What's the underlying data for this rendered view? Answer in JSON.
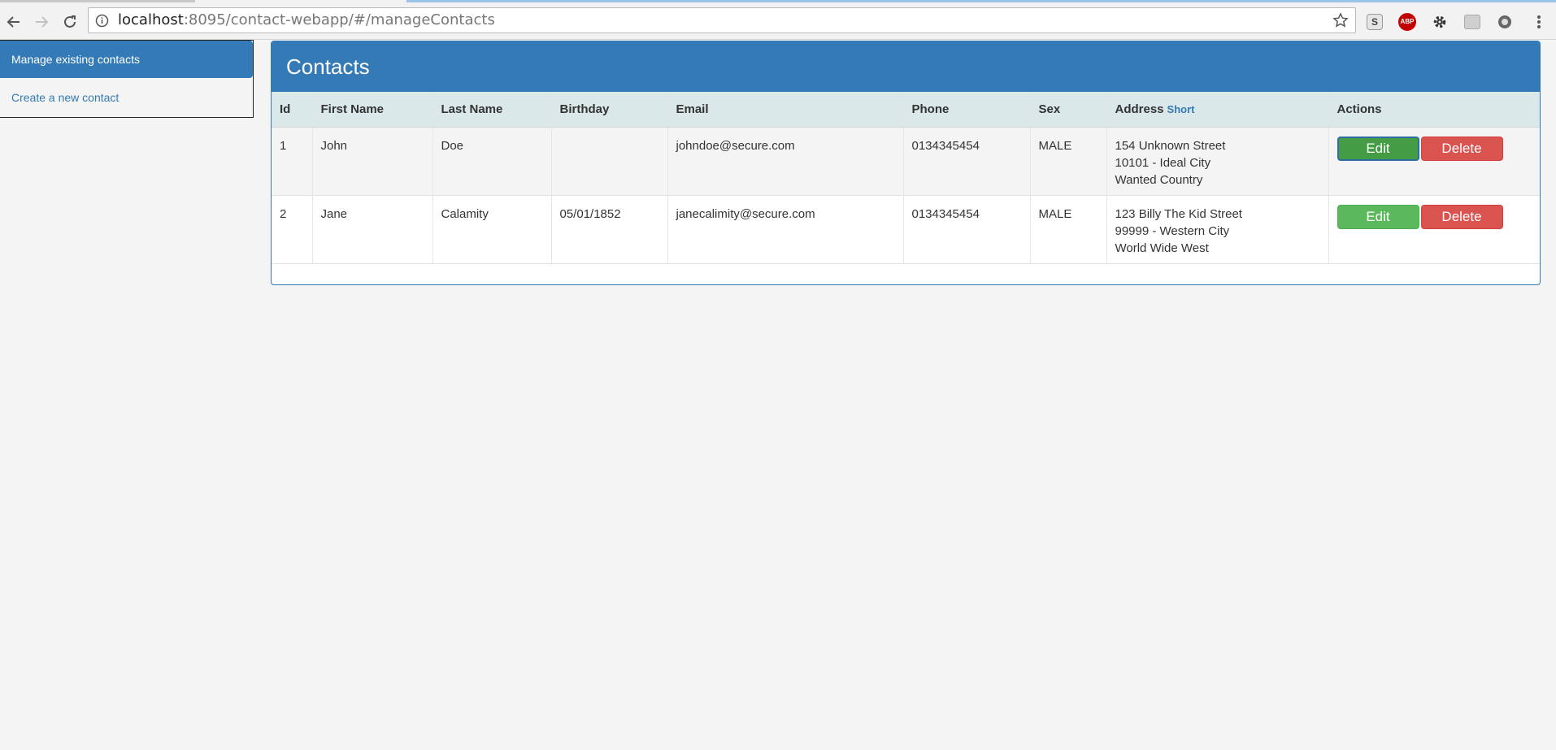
{
  "browser": {
    "url_host": "localhost",
    "url_rest": ":8095/contact-webapp/#/manageContacts",
    "extensions": [
      "S",
      "ABP"
    ]
  },
  "sidebar": {
    "items": [
      {
        "label": "Manage existing contacts",
        "active": true
      },
      {
        "label": "Create a new contact",
        "active": false
      }
    ]
  },
  "panel": {
    "title": "Contacts",
    "columns": {
      "id": "Id",
      "first_name": "First Name",
      "last_name": "Last Name",
      "birthday": "Birthday",
      "email": "Email",
      "phone": "Phone",
      "sex": "Sex",
      "address": "Address",
      "address_toggle": "Short",
      "actions": "Actions"
    },
    "rows": [
      {
        "id": "1",
        "first_name": "John",
        "last_name": "Doe",
        "birthday": "",
        "email": "johndoe@secure.com",
        "phone": "0134345454",
        "sex": "MALE",
        "address": [
          "154 Unknown Street",
          "10101 - Ideal City",
          "Wanted Country"
        ],
        "edit_label": "Edit",
        "delete_label": "Delete"
      },
      {
        "id": "2",
        "first_name": "Jane",
        "last_name": "Calamity",
        "birthday": "05/01/1852",
        "email": "janecalimity@secure.com",
        "phone": "0134345454",
        "sex": "MALE",
        "address": [
          "123 Billy The Kid Street",
          "99999 - Western City",
          "World Wide West"
        ],
        "edit_label": "Edit",
        "delete_label": "Delete"
      }
    ]
  },
  "colors": {
    "primary": "#337ab7",
    "success": "#5cb85c",
    "danger": "#d9534f",
    "table_header": "#dbe8e9"
  }
}
